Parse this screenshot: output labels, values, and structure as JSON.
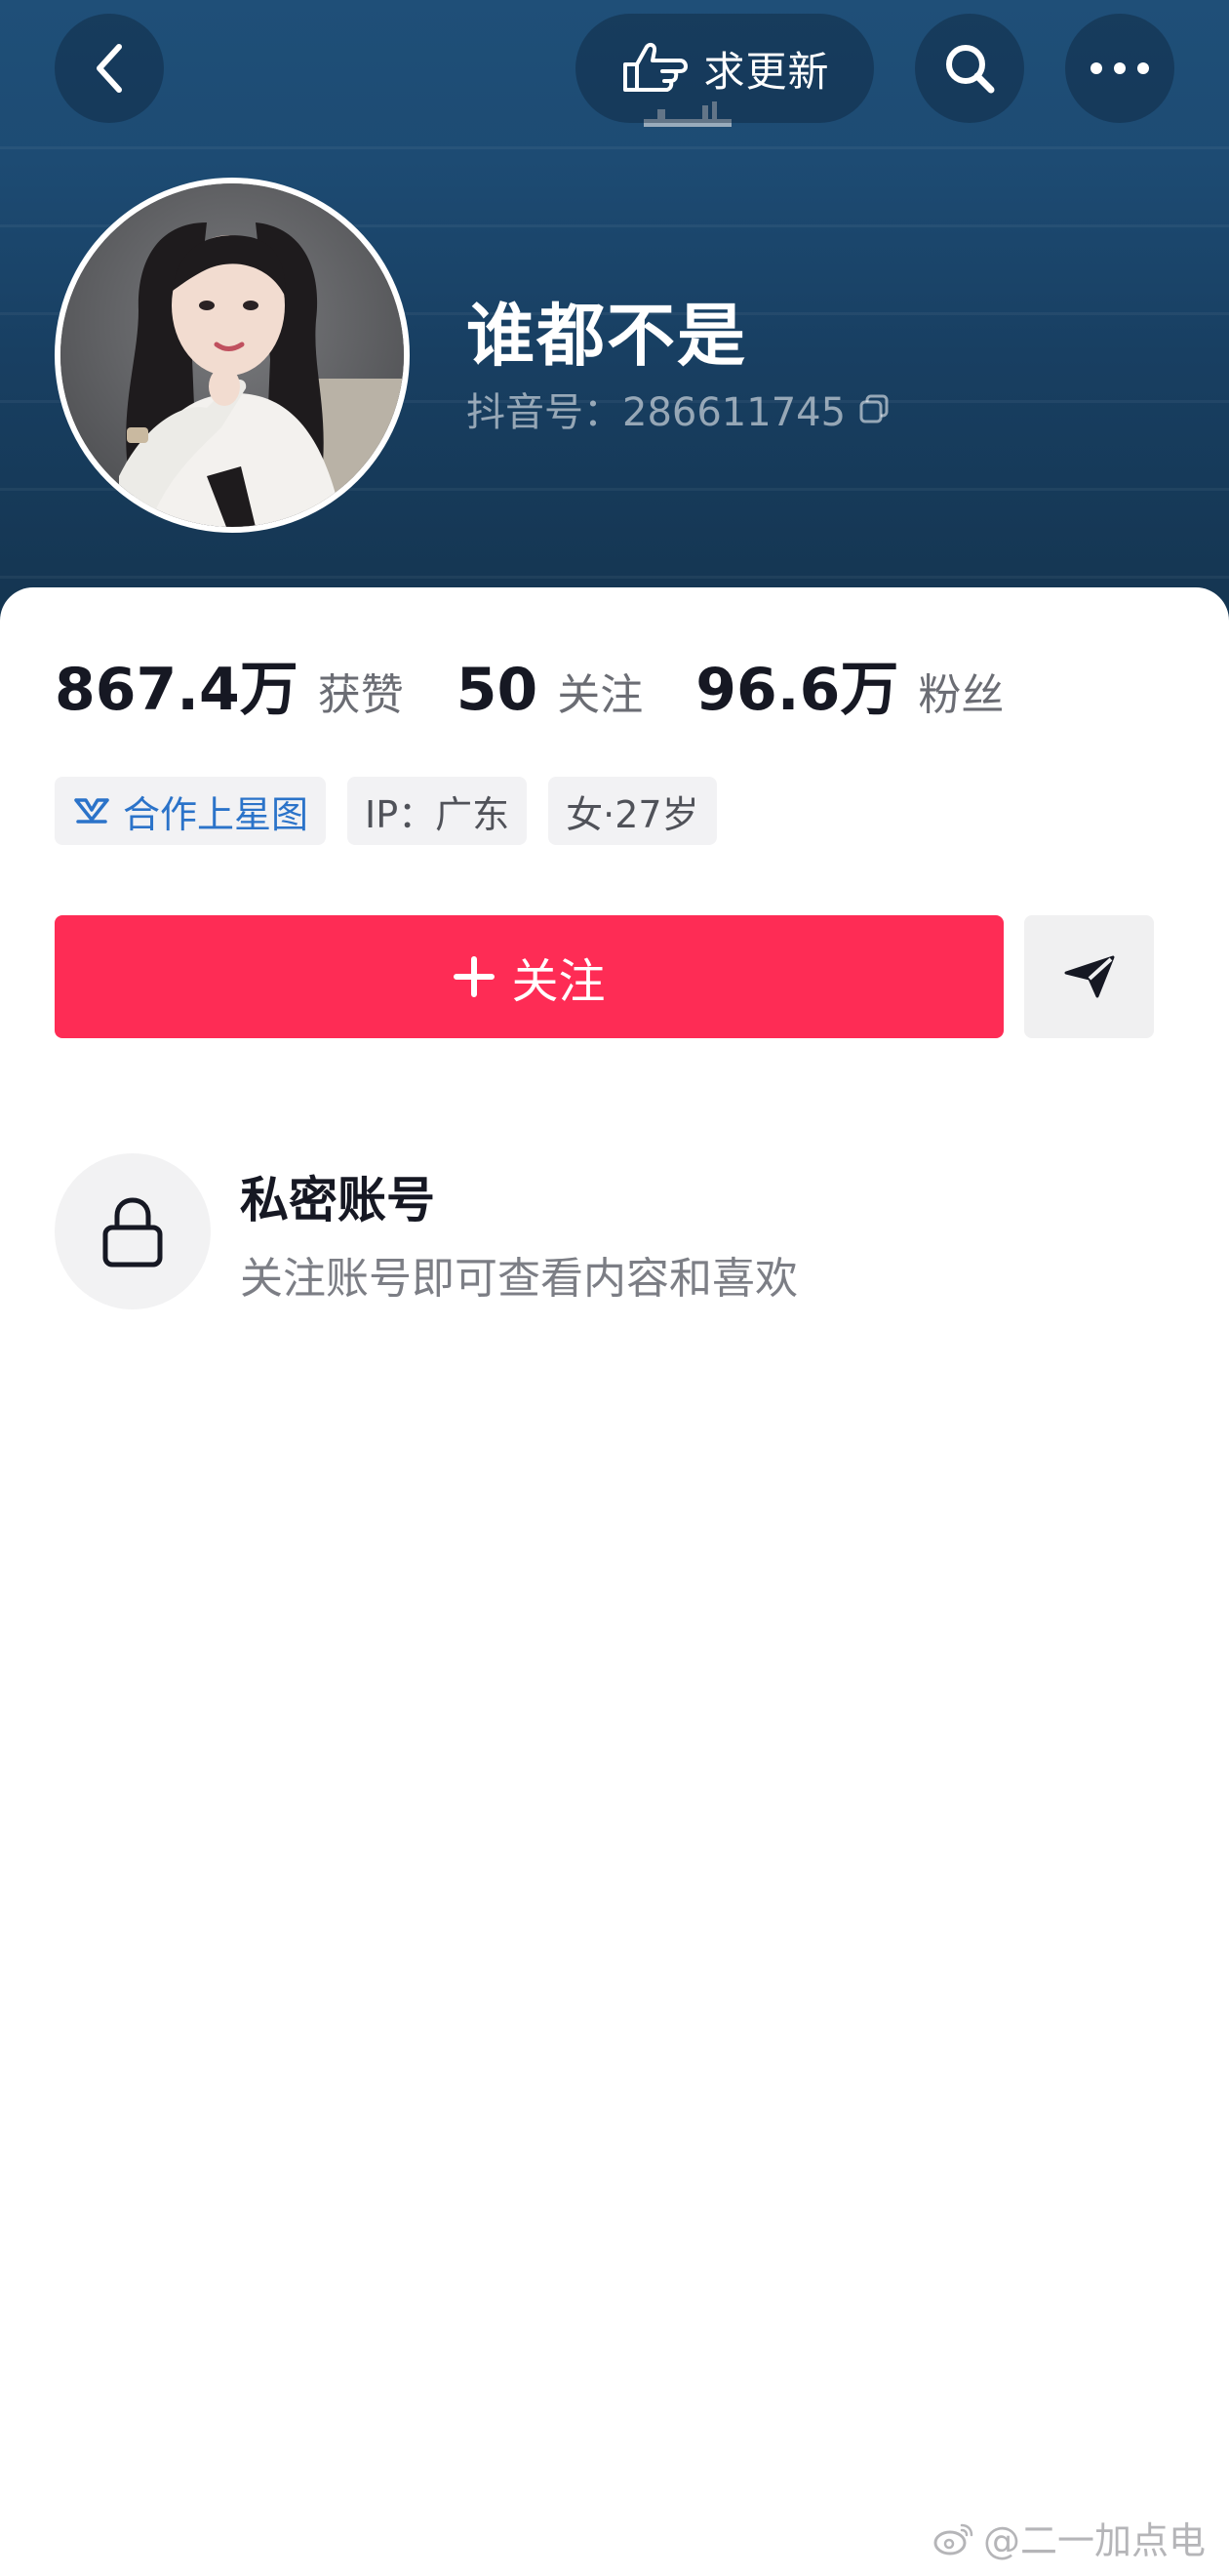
{
  "header": {
    "update_label": "求更新",
    "colors": {
      "background": "#1d4b73",
      "button_overlay": "rgba(10,30,50,0.38)"
    }
  },
  "profile": {
    "nickname": "谁都不是",
    "douyin_id": "抖音号：286611745"
  },
  "stats": [
    {
      "value": "867.4万",
      "label": "获赞"
    },
    {
      "value": "50",
      "label": "关注"
    },
    {
      "value": "96.6万",
      "label": "粉丝"
    }
  ],
  "tags": [
    {
      "label": "合作上星图",
      "icon": "xingtu-icon"
    },
    {
      "label": "IP：广东"
    },
    {
      "label": "女·27岁"
    }
  ],
  "actions": {
    "follow_label": "关注",
    "follow_color": "#fe2c55"
  },
  "private": {
    "title": "私密账号",
    "subtitle": "关注账号即可查看内容和喜欢"
  },
  "watermark": {
    "text": "@二一加点电",
    "icon": "weibo-icon"
  }
}
